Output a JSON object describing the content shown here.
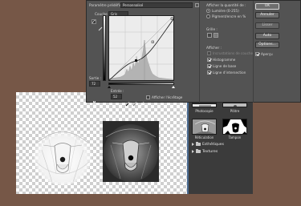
{
  "curves": {
    "preset_label": "Paramètre prédéfini :",
    "preset_value": "Personnalisé",
    "channel_label": "Couche :",
    "channel_value": "Gris",
    "output_label": "Sortie :",
    "output_value": "72",
    "input_label": "Entrée :",
    "input_value": "52",
    "show_clipping_label": "Afficher l'écrêtage",
    "display_amount_label": "Afficher la quantité de :",
    "light_option": "Lumière (0-255)",
    "pigment_option": "Pigment/encre en %",
    "grid_label": "Grille :",
    "show_label": "Afficher :",
    "channel_overlays_label": "Incrustations de couche",
    "histogram_label": "Histogramme",
    "baseline_label": "Ligne de base",
    "intersection_label": "Ligne d'intersection",
    "ok_label": "OK",
    "cancel_label": "Annuler",
    "smooth_label": "Lisser",
    "auto_label": "Auto",
    "options_label": "Options...",
    "preview_label": "Aperçu"
  },
  "filter_gallery": {
    "thumbs": [
      {
        "label": "Photocopie"
      },
      {
        "label": "Plâtre"
      },
      {
        "label": "Réticulation"
      },
      {
        "label": "Tampon"
      }
    ],
    "folders": [
      {
        "label": "Esthétiques"
      },
      {
        "label": "Textures"
      }
    ]
  },
  "colors": {
    "desktop": "#765747",
    "dialog": "#535353",
    "panel": "#3b3b3b"
  }
}
